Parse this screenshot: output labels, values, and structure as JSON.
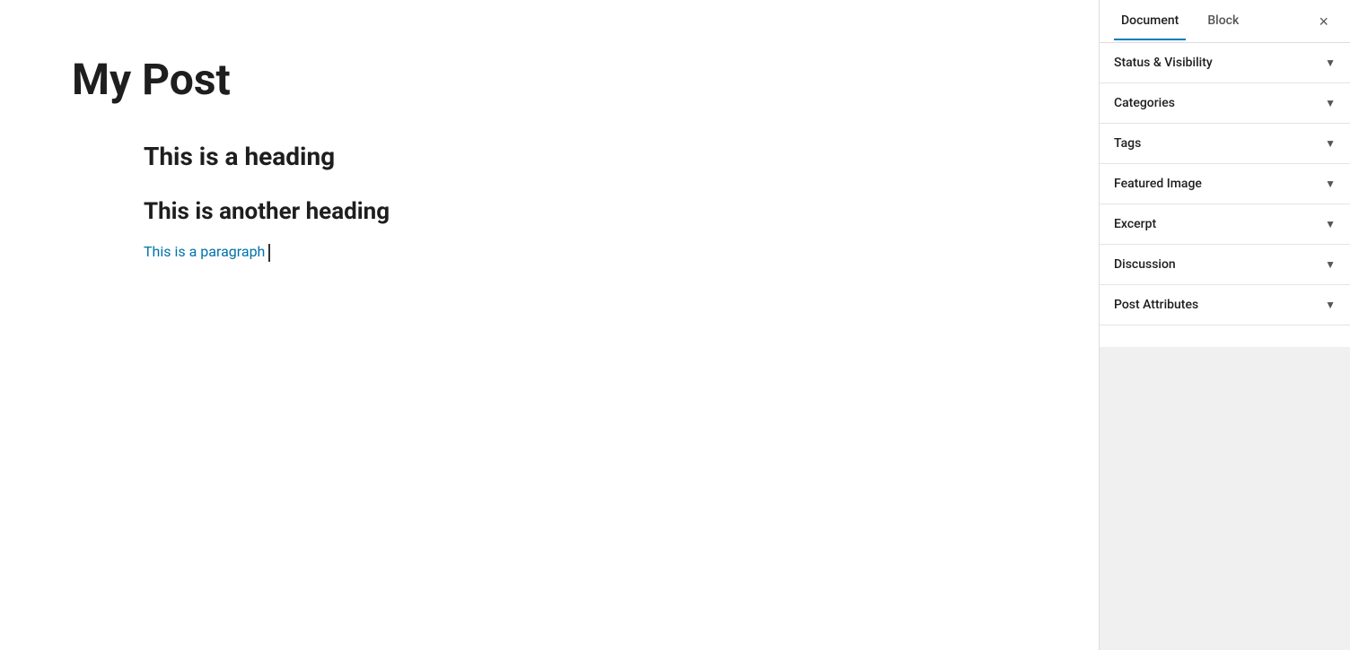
{
  "editor": {
    "post_title": "My Post",
    "content": {
      "heading1": "This is a heading",
      "heading2": "This is another heading",
      "paragraph": "This is a paragraph"
    }
  },
  "sidebar": {
    "tabs": [
      {
        "id": "document",
        "label": "Document",
        "active": true
      },
      {
        "id": "block",
        "label": "Block",
        "active": false
      }
    ],
    "close_button_label": "×",
    "panels": [
      {
        "id": "status-visibility",
        "label": "Status & Visibility"
      },
      {
        "id": "categories",
        "label": "Categories"
      },
      {
        "id": "tags",
        "label": "Tags"
      },
      {
        "id": "featured-image",
        "label": "Featured Image"
      },
      {
        "id": "excerpt",
        "label": "Excerpt"
      },
      {
        "id": "discussion",
        "label": "Discussion"
      },
      {
        "id": "post-attributes",
        "label": "Post Attributes"
      }
    ],
    "chevron": "▼"
  }
}
